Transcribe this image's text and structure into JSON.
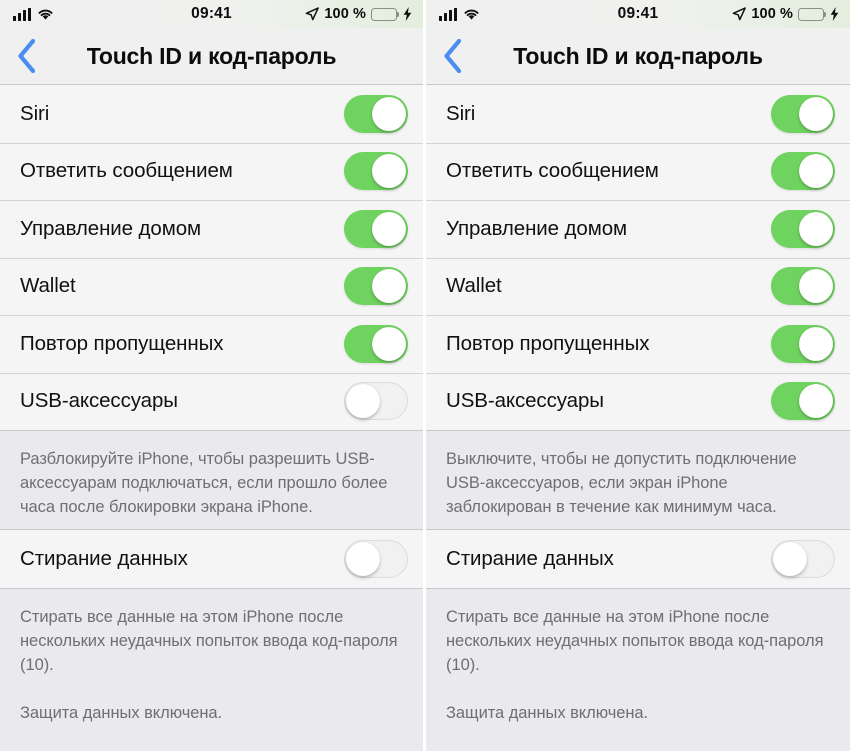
{
  "statusbar": {
    "time": "09:41",
    "battery_percent": "100 %",
    "signal_icon": "cellular-signal-icon",
    "wifi_icon": "wifi-icon",
    "location_icon": "location-arrow-icon",
    "battery_icon": "battery-full-icon",
    "charging_icon": "charging-bolt-icon"
  },
  "navbar": {
    "back_icon": "chevron-left-icon",
    "title": "Touch ID и код-пароль"
  },
  "colors": {
    "switch_on": "#6fd35f",
    "switch_off_track": "#f1f1f1",
    "accent_blue": "#4a8ef0",
    "row_bg": "#f5f5f5",
    "group_bg": "#e9e9ee",
    "label_text": "#111111",
    "footer_text": "#6e6e73"
  },
  "panels": [
    {
      "id": "left",
      "rows": [
        {
          "label": "Siri",
          "state": "on"
        },
        {
          "label": "Ответить сообщением",
          "state": "on"
        },
        {
          "label": "Управление домом",
          "state": "on"
        },
        {
          "label": "Wallet",
          "state": "on"
        },
        {
          "label": "Повтор пропущенных",
          "state": "on"
        },
        {
          "label": "USB-аксессуары",
          "state": "off"
        }
      ],
      "footer": "Разблокируйте iPhone, чтобы разрешить USB-аксессуарам подключаться, если прошло более часа после блокировки экрана iPhone.",
      "erase_row": {
        "label": "Стирание данных",
        "state": "off"
      },
      "erase_footer_1": "Стирать все данные на этом iPhone после нескольких неудачных попыток ввода код-пароля (10).",
      "erase_footer_2": "Защита данных включена."
    },
    {
      "id": "right",
      "rows": [
        {
          "label": "Siri",
          "state": "on"
        },
        {
          "label": "Ответить сообщением",
          "state": "on"
        },
        {
          "label": "Управление домом",
          "state": "on"
        },
        {
          "label": "Wallet",
          "state": "on"
        },
        {
          "label": "Повтор пропущенных",
          "state": "on"
        },
        {
          "label": "USB-аксессуары",
          "state": "on"
        }
      ],
      "footer": "Выключите, чтобы не допустить подключение USB-аксессуаров, если экран iPhone заблокирован в течение как минимум часа.",
      "erase_row": {
        "label": "Стирание данных",
        "state": "off"
      },
      "erase_footer_1": "Стирать все данные на этом iPhone после нескольких неудачных попыток ввода код-пароля (10).",
      "erase_footer_2": "Защита данных включена."
    }
  ]
}
